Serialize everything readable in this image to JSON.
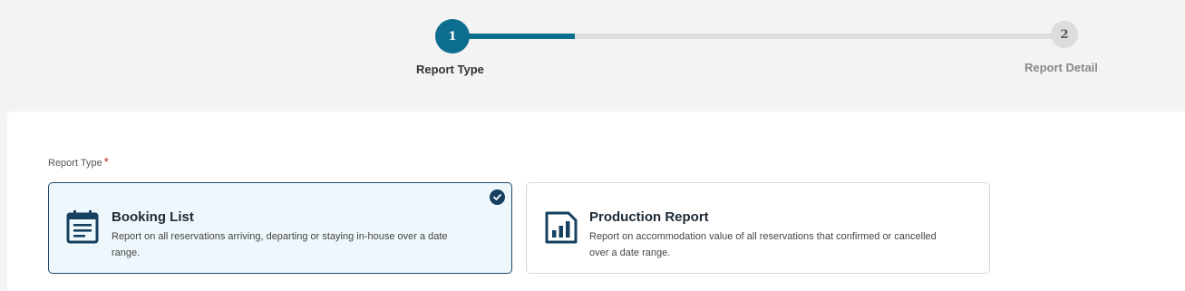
{
  "stepper": {
    "steps": [
      {
        "number": "1",
        "label": "Report Type"
      },
      {
        "number": "2",
        "label": "Report Detail"
      }
    ],
    "progress_fraction": 0.2
  },
  "form": {
    "field_label": "Report Type",
    "required_mark": "*",
    "options": [
      {
        "title": "Booking List",
        "description": "Report on all reservations arriving, departing or staying in-house over a date range.",
        "icon": "calendar-list-icon",
        "selected": true
      },
      {
        "title": "Production Report",
        "description": "Report on accommodation value of all reservations that confirmed or cancelled over a date range.",
        "icon": "bar-chart-icon",
        "selected": false
      }
    ]
  },
  "colors": {
    "accent": "#0e6e8f",
    "selected_border": "#1c4a6e",
    "selected_bg": "#eef7fc",
    "required": "#d02020"
  }
}
